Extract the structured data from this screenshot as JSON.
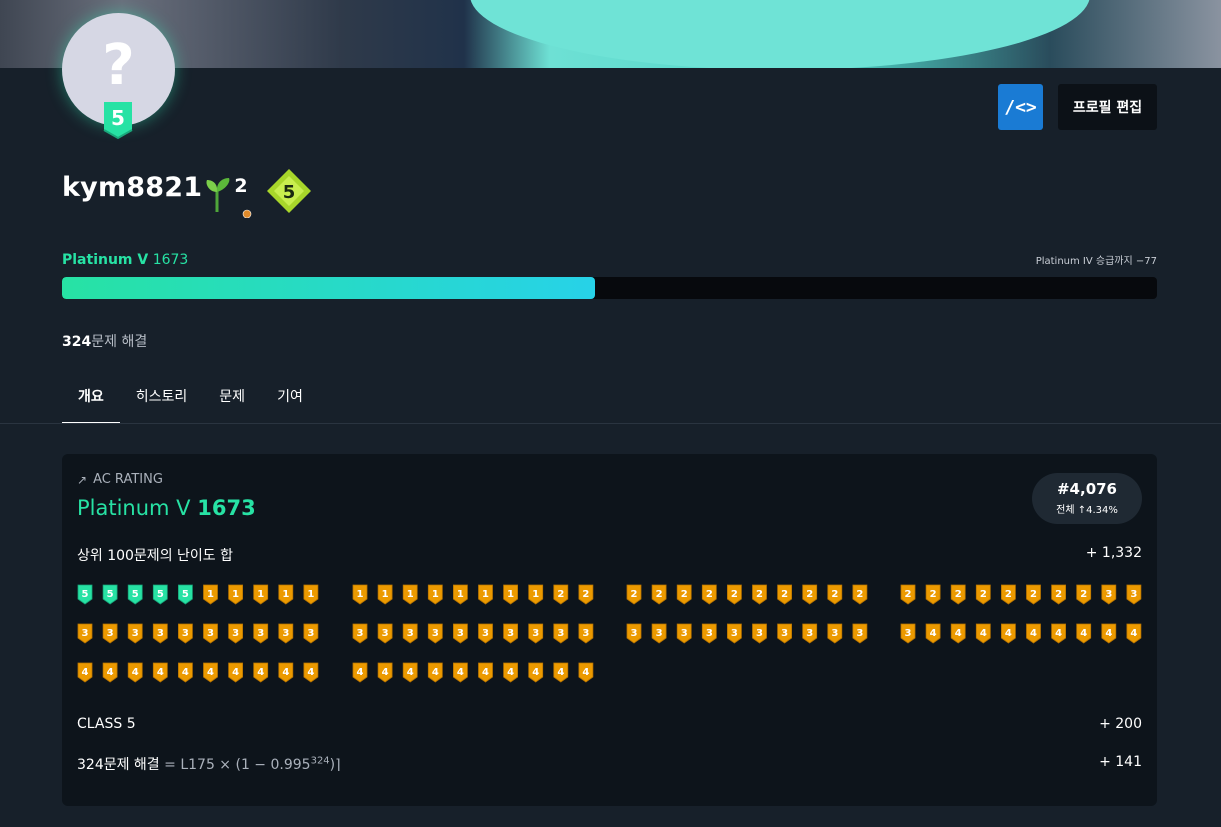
{
  "header": {
    "avatar_icon": "question-mark-icon",
    "avatar_tier_level": "5",
    "code_button_label": "/<>",
    "edit_button_label": "프로필 편집"
  },
  "profile": {
    "username": "kym8821",
    "sprout_badge_number": "2",
    "class_badge_number": "5",
    "tier_name": "Platinum V",
    "tier_rating": "1673",
    "next_tier_text": "Platinum IV 승급까지 −77",
    "progress_fraction": 0.487,
    "solved_count": "324",
    "solved_suffix": "문제 해결"
  },
  "tabs": [
    "개요",
    "히스토리",
    "문제",
    "기여"
  ],
  "ac_rating": {
    "label": "AC RATING",
    "tier_name": "Platinum V",
    "rating": "1673",
    "rank": "#4,076",
    "rank_sub": "전체 ↑4.34%",
    "top100_label": "상위 100문제의 난이도 합",
    "top100_value": "+ 1,332",
    "class_label": "CLASS 5",
    "class_value": "+ 200",
    "solved_label": "324문제 해결",
    "solved_formula_prefix": "= L175 × (1 − 0.995",
    "solved_formula_exp": "324",
    "solved_formula_suffix": ")⌉",
    "solved_value": "+ 141"
  },
  "top100_tiers": [
    "P5",
    "P5",
    "P5",
    "P5",
    "P5",
    "G1",
    "G1",
    "G1",
    "G1",
    "G1",
    "G1",
    "G1",
    "G1",
    "G1",
    "G1",
    "G1",
    "G1",
    "G1",
    "G2",
    "G2",
    "G2",
    "G2",
    "G2",
    "G2",
    "G2",
    "G2",
    "G2",
    "G2",
    "G2",
    "G2",
    "G2",
    "G2",
    "G2",
    "G2",
    "G2",
    "G2",
    "G2",
    "G2",
    "G3",
    "G3",
    "G3",
    "G3",
    "G3",
    "G3",
    "G3",
    "G3",
    "G3",
    "G3",
    "G3",
    "G3",
    "G3",
    "G3",
    "G3",
    "G3",
    "G3",
    "G3",
    "G3",
    "G3",
    "G3",
    "G3",
    "G3",
    "G3",
    "G3",
    "G3",
    "G3",
    "G3",
    "G3",
    "G3",
    "G3",
    "G3",
    "G3",
    "G4",
    "G4",
    "G4",
    "G4",
    "G4",
    "G4",
    "G4",
    "G4",
    "G4",
    "G4",
    "G4",
    "G4",
    "G4",
    "G4",
    "G4",
    "G4",
    "G4",
    "G4",
    "G4",
    "G4",
    "G4",
    "G4",
    "G4",
    "G4",
    "G4",
    "G4",
    "G4",
    "G4",
    "G4"
  ],
  "colors": {
    "platinum": "#27e2a4",
    "gold": "#ec9a00",
    "code_button": "#1a7bd4"
  }
}
